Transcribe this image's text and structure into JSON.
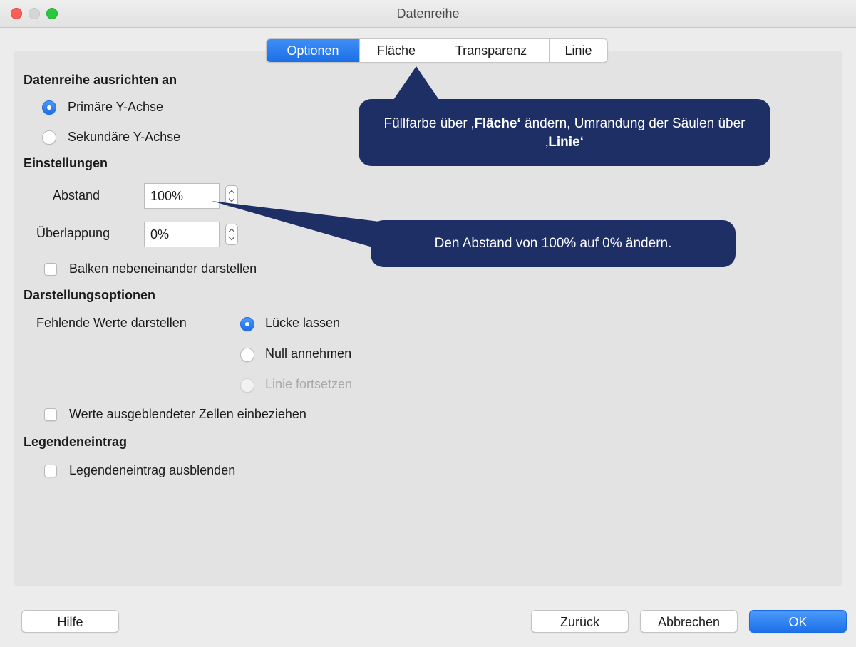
{
  "window": {
    "title": "Datenreihe"
  },
  "tabs": [
    {
      "label": "Optionen",
      "active": true
    },
    {
      "label": "Fläche",
      "active": false
    },
    {
      "label": "Transparenz",
      "active": false
    },
    {
      "label": "Linie",
      "active": false
    }
  ],
  "align": {
    "heading": "Datenreihe ausrichten an",
    "primary_label": "Primäre Y-Achse",
    "primary_selected": true,
    "secondary_label": "Sekundäre Y-Achse",
    "secondary_selected": false
  },
  "settings": {
    "heading": "Einstellungen",
    "spacing_label": "Abstand",
    "spacing_value": "100%",
    "overlap_label": "Überlappung",
    "overlap_value": "0%",
    "side_by_side_label": "Balken nebeneinander darstellen",
    "side_by_side_checked": false
  },
  "display": {
    "heading": "Darstellungsoptionen",
    "missing_label": "Fehlende Werte darstellen",
    "options": [
      {
        "label": "Lücke lassen",
        "selected": true,
        "enabled": true
      },
      {
        "label": "Null annehmen",
        "selected": false,
        "enabled": true
      },
      {
        "label": "Linie fortsetzen",
        "selected": false,
        "enabled": false
      }
    ],
    "hidden_cells_label": "Werte ausgeblendeter Zellen einbeziehen",
    "hidden_cells_checked": false
  },
  "legend": {
    "heading": "Legendeneintrag",
    "hide_label": "Legendeneintrag ausblenden",
    "hide_checked": false
  },
  "buttons": {
    "help": "Hilfe",
    "back": "Zurück",
    "cancel": "Abbrechen",
    "ok": "OK"
  },
  "callouts": {
    "tabs": {
      "text_1": "Füllfarbe über ‚",
      "bold_1": "Fläche‘",
      "text_2": " ändern, Umrandung der Säulen über ‚",
      "bold_2": "Linie‘"
    },
    "spacing": {
      "text": "Den Abstand von 100% auf 0% ändern."
    }
  },
  "colors": {
    "accent": "#1f6ee6",
    "callout": "#1e2f66",
    "panel": "#e3e3e3"
  }
}
